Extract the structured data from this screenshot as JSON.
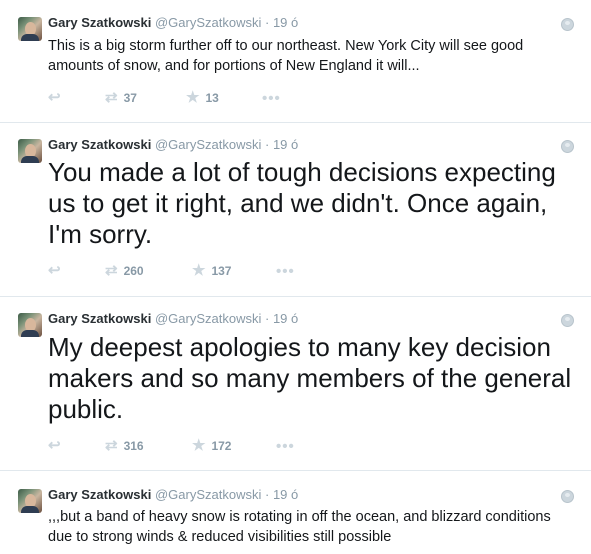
{
  "tweets": [
    {
      "name": "Gary Szatkowski",
      "handle": "@GarySzatkowski",
      "separator": "·",
      "time": "19 ó",
      "text": "This is a big storm further off to our northeast.  New York City will see good amounts of snow, and for portions of New England it will...",
      "retweets": "37",
      "favorites": "13"
    },
    {
      "name": "Gary Szatkowski",
      "handle": "@GarySzatkowski",
      "separator": "·",
      "time": "19 ó",
      "text": "You made a lot of tough decisions expecting us to get it right, and we didn't.  Once again, I'm sorry.",
      "retweets": "260",
      "favorites": "137"
    },
    {
      "name": "Gary Szatkowski",
      "handle": "@GarySzatkowski",
      "separator": "·",
      "time": "19 ó",
      "text": "My deepest apologies to many key decision makers and so many members of the general public.",
      "retweets": "316",
      "favorites": "172"
    },
    {
      "name": "Gary Szatkowski",
      "handle": "@GarySzatkowski",
      "separator": "·",
      "time": "19 ó",
      "text": ",,,but a band of heavy snow is rotating in off the ocean, and blizzard conditions due to strong winds & reduced visibilities still possible",
      "retweets": "",
      "favorites": ""
    }
  ],
  "icons": {
    "reply": "reply-icon",
    "retweet": "retweet-icon",
    "favorite": "star-icon",
    "more": "more-icon",
    "globe": "globe-icon"
  }
}
